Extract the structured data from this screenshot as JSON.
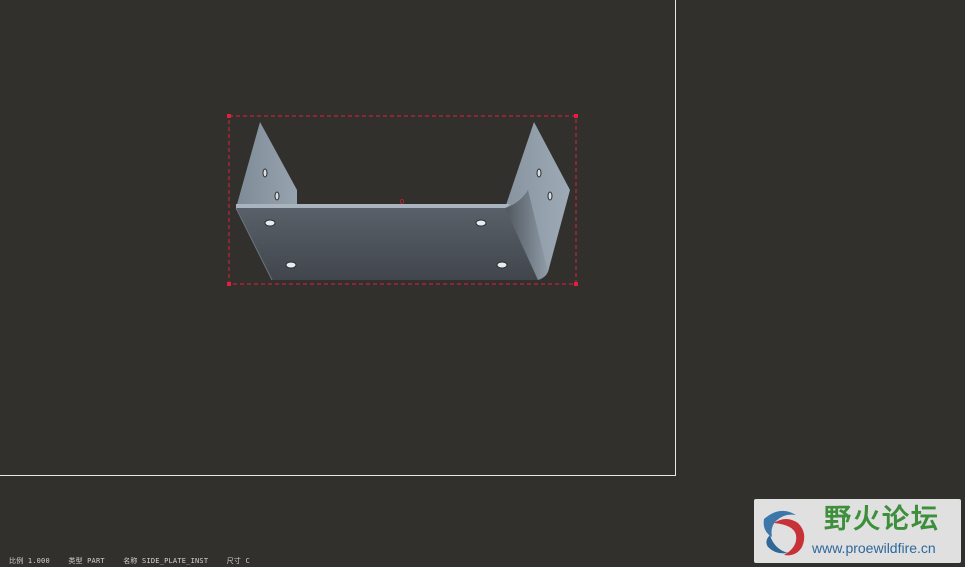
{
  "viewport": {
    "background_color": "#32302d",
    "sheet_border_color": "#e6e6e6",
    "selection_color": "#e0203c"
  },
  "model": {
    "name": "SIDE_PLATE_INST",
    "type": "PART",
    "color_front": "#4a4f55",
    "color_flange": "#8a97a3",
    "color_highlight": "#a8b3bd",
    "center_marker": "0"
  },
  "status_bar": {
    "scale": "比例 1.000",
    "type": "类型 PART",
    "name": "名称 SIDE_PLATE_INST",
    "size": "尺寸 C"
  },
  "watermark": {
    "logo_icon": "swirl-logo-icon",
    "title": "野火论坛",
    "url": "www.proewildfire.cn"
  }
}
